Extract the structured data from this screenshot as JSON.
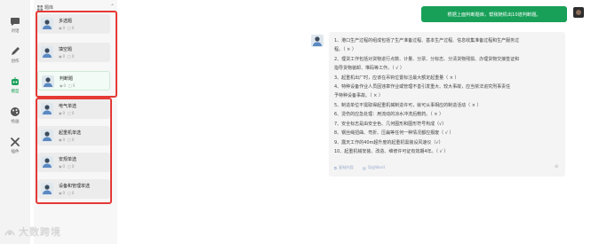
{
  "nav": {
    "items": [
      {
        "label": "对话",
        "icon": "chat-bubble-icon"
      },
      {
        "label": "创作",
        "icon": "pen-icon"
      },
      {
        "label": "模型",
        "icon": "robot-icon",
        "active": true
      },
      {
        "label": "绘画",
        "icon": "palette-icon"
      },
      {
        "label": "插件",
        "icon": "tools-icon"
      }
    ]
  },
  "panel": {
    "header": "题库",
    "cards": [
      {
        "title": "多选题",
        "views": "0",
        "comments": "0"
      },
      {
        "title": "填空题",
        "views": "0",
        "comments": "0"
      },
      {
        "title": "判断题",
        "views": "0",
        "comments": "0",
        "active": true
      },
      {
        "title": "电气单选",
        "views": "0",
        "comments": "0"
      },
      {
        "title": "起重机单选",
        "views": "0",
        "comments": "0"
      },
      {
        "title": "安规单选",
        "views": "0",
        "comments": "0"
      },
      {
        "title": "设备和管理单选",
        "views": "0",
        "comments": "0"
      }
    ]
  },
  "chat": {
    "user_message": "根据上面判断题库，帮我随机出10道判断题。",
    "answer_lines": [
      "1、港口生产过程的组成包括了生产准备过程、基本生产过程、信息收集准备过程和生产服务过",
      "程。（ × ）",
      "2、理货工作包括对货物进行点数、计量、分票、分标志、分清货物残损、办理货物交接签证和",
      "指导货物装卸、堆码等工作。（ √ ）",
      "3、起重机出厂时，应该在吊钩位置标注最大额定起重量（ × ）",
      "4、特种设备作业人员因违章作业或管理不善引发重大、较大事故，应当依法追究刑事责任",
      "予特种设备事故。（ × ）",
      "5、制造单位不需取得起重机械制造许可，就可从事相应的制造活动（ × ）",
      "6、烫伤的应急处理：用流动的凉水冲洗后敷药。（ × ）",
      "7、安全标志是由安全色、几何图形和图形符号构成（√）",
      "8、钢丝绳扭曲、弯折、压扁等任何一种情况都应报废（ √ ）",
      "9、露天工作的40m超升度的起重机需装设风速仪（√）",
      "10、起重机械安装、改造、维修许可证有效期4年。（ √ ）"
    ],
    "footer": {
      "copy_label": "复制内容",
      "export_label": "导出Word"
    }
  },
  "watermark": {
    "text": "大数跨境"
  }
}
